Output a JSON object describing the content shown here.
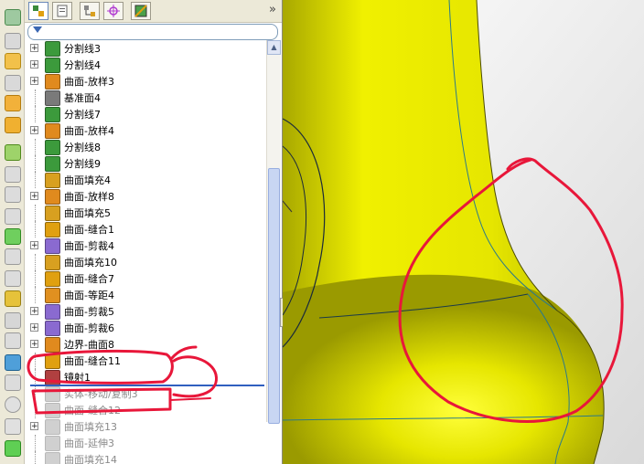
{
  "feature_tree": {
    "filter": {
      "placeholder": ""
    },
    "items": [
      {
        "label": "分割线3",
        "icon": "split-line-icon",
        "color": "#3c9a3c",
        "expandable": true,
        "dim": false
      },
      {
        "label": "分割线4",
        "icon": "split-line-icon",
        "color": "#3c9a3c",
        "expandable": true,
        "dim": false
      },
      {
        "label": "曲面-放样3",
        "icon": "surface-loft-icon",
        "color": "#e08a1e",
        "expandable": true,
        "dim": false
      },
      {
        "label": "基准面4",
        "icon": "plane-icon",
        "color": "#7a7a7a",
        "expandable": false,
        "dim": false
      },
      {
        "label": "分割线7",
        "icon": "split-line-icon",
        "color": "#3c9a3c",
        "expandable": false,
        "dim": false
      },
      {
        "label": "曲面-放样4",
        "icon": "surface-loft-icon",
        "color": "#e08a1e",
        "expandable": true,
        "dim": false
      },
      {
        "label": "分割线8",
        "icon": "split-line-icon",
        "color": "#3c9a3c",
        "expandable": false,
        "dim": false
      },
      {
        "label": "分割线9",
        "icon": "split-line-icon",
        "color": "#3c9a3c",
        "expandable": false,
        "dim": false
      },
      {
        "label": "曲面填充4",
        "icon": "surface-fill-icon",
        "color": "#d8a020",
        "expandable": false,
        "dim": false
      },
      {
        "label": "曲面-放样8",
        "icon": "surface-loft-icon",
        "color": "#e08a1e",
        "expandable": true,
        "dim": false
      },
      {
        "label": "曲面填充5",
        "icon": "surface-fill-icon",
        "color": "#d8a020",
        "expandable": false,
        "dim": false
      },
      {
        "label": "曲面-缝合1",
        "icon": "surface-knit-icon",
        "color": "#e0a010",
        "expandable": false,
        "dim": false
      },
      {
        "label": "曲面-剪裁4",
        "icon": "surface-trim-icon",
        "color": "#8a6ad0",
        "expandable": true,
        "dim": false
      },
      {
        "label": "曲面填充10",
        "icon": "surface-fill-icon",
        "color": "#d8a020",
        "expandable": false,
        "dim": false
      },
      {
        "label": "曲面-缝合7",
        "icon": "surface-knit-icon",
        "color": "#e0a010",
        "expandable": false,
        "dim": false
      },
      {
        "label": "曲面-等距4",
        "icon": "surface-offset-icon",
        "color": "#e09020",
        "expandable": false,
        "dim": false
      },
      {
        "label": "曲面-剪裁5",
        "icon": "surface-trim-icon",
        "color": "#8a6ad0",
        "expandable": true,
        "dim": false
      },
      {
        "label": "曲面-剪裁6",
        "icon": "surface-trim-icon",
        "color": "#8a6ad0",
        "expandable": true,
        "dim": false
      },
      {
        "label": "边界-曲面8",
        "icon": "boundary-surface-icon",
        "color": "#e08a1e",
        "expandable": true,
        "dim": false
      },
      {
        "label": "曲面-缝合11",
        "icon": "surface-knit-icon",
        "color": "#e0a010",
        "expandable": false,
        "dim": false
      },
      {
        "label": "镜射1",
        "icon": "mirror-icon",
        "color": "#b04040",
        "expandable": false,
        "dim": false
      },
      {
        "label": "实体-移动/复制3",
        "icon": "move-copy-icon",
        "color": "#999999",
        "expandable": false,
        "dim": true
      },
      {
        "label": "曲面-缝合12",
        "icon": "surface-knit-icon",
        "color": "#999999",
        "expandable": false,
        "dim": true
      },
      {
        "label": "曲面填充13",
        "icon": "surface-fill-icon",
        "color": "#999999",
        "expandable": true,
        "dim": true
      },
      {
        "label": "曲面-延伸3",
        "icon": "surface-extend-icon",
        "color": "#999999",
        "expandable": false,
        "dim": true
      },
      {
        "label": "曲面填充14",
        "icon": "surface-fill-icon",
        "color": "#999999",
        "expandable": false,
        "dim": true
      }
    ]
  },
  "colors": {
    "part_yellow": "#e8e800",
    "part_shadow": "#8a8a00",
    "annotation_red": "#e8173a",
    "rollback_bar": "#2f5fbf"
  }
}
